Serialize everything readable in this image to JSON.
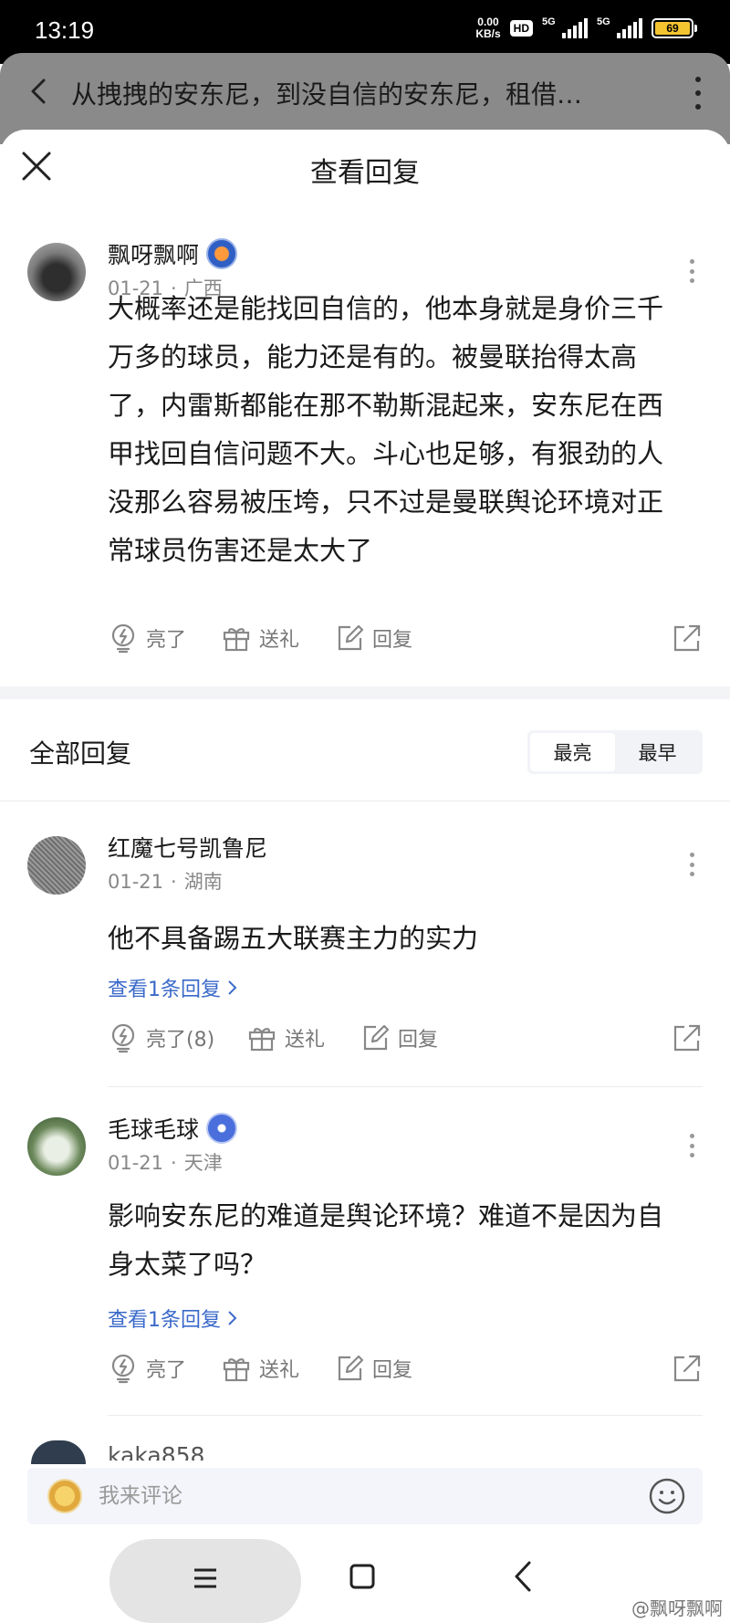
{
  "status_bar": {
    "time": "13:19",
    "net_speed_value": "0.00",
    "net_speed_unit": "KB/s",
    "hd_label": "HD",
    "signal_1_label": "5G",
    "signal_2_label": "5G",
    "battery": "69"
  },
  "header": {
    "title": "从拽拽的安东尼，到没自信的安东尼，租借…"
  },
  "sheet": {
    "title": "查看回复"
  },
  "main_comment": {
    "username": "飘呀飘啊",
    "date": "01-21",
    "separator": "·",
    "location": "广西",
    "content": "大概率还是能找回自信的，他本身就是身价三千万多的球员，能力还是有的。被曼联抬得太高了，内雷斯都能在那不勒斯混起来，安东尼在西甲找回自信问题不大。斗心也足够，有狠劲的人没那么容易被压垮，只不过是曼联舆论环境对正常球员伤害还是太大了",
    "like_label": "亮了",
    "gift_label": "送礼",
    "reply_label": "回复"
  },
  "replies_section": {
    "title": "全部回复",
    "sort_options": [
      "最亮",
      "最早"
    ],
    "active_sort": "最早"
  },
  "replies": [
    {
      "username": "红魔七号凯鲁尼",
      "date": "01-21",
      "separator": "·",
      "location": "湖南",
      "content": "他不具备踢五大联赛主力的实力",
      "view_replies": "查看1条回复",
      "like_label": "亮了(8)",
      "gift_label": "送礼",
      "reply_label": "回复"
    },
    {
      "username": "毛球毛球",
      "date": "01-21",
      "separator": "·",
      "location": "天津",
      "content": "影响安东尼的难道是舆论环境？难道不是因为自身太菜了吗？",
      "view_replies": "查看1条回复",
      "like_label": "亮了",
      "gift_label": "送礼",
      "reply_label": "回复"
    }
  ],
  "peek_username": "kaka858",
  "input": {
    "placeholder": "我来评论"
  },
  "watermark": "@飘呀飘啊",
  "icons": {
    "back": "back-arrow-icon",
    "more": "more-vertical-icon",
    "close": "close-icon",
    "like": "lightning-bulb-icon",
    "gift": "gift-icon",
    "reply": "edit-reply-icon",
    "share": "share-icon",
    "emoji": "smiley-icon"
  },
  "colors": {
    "link": "#3a69c9",
    "battery": "#f4c430"
  }
}
